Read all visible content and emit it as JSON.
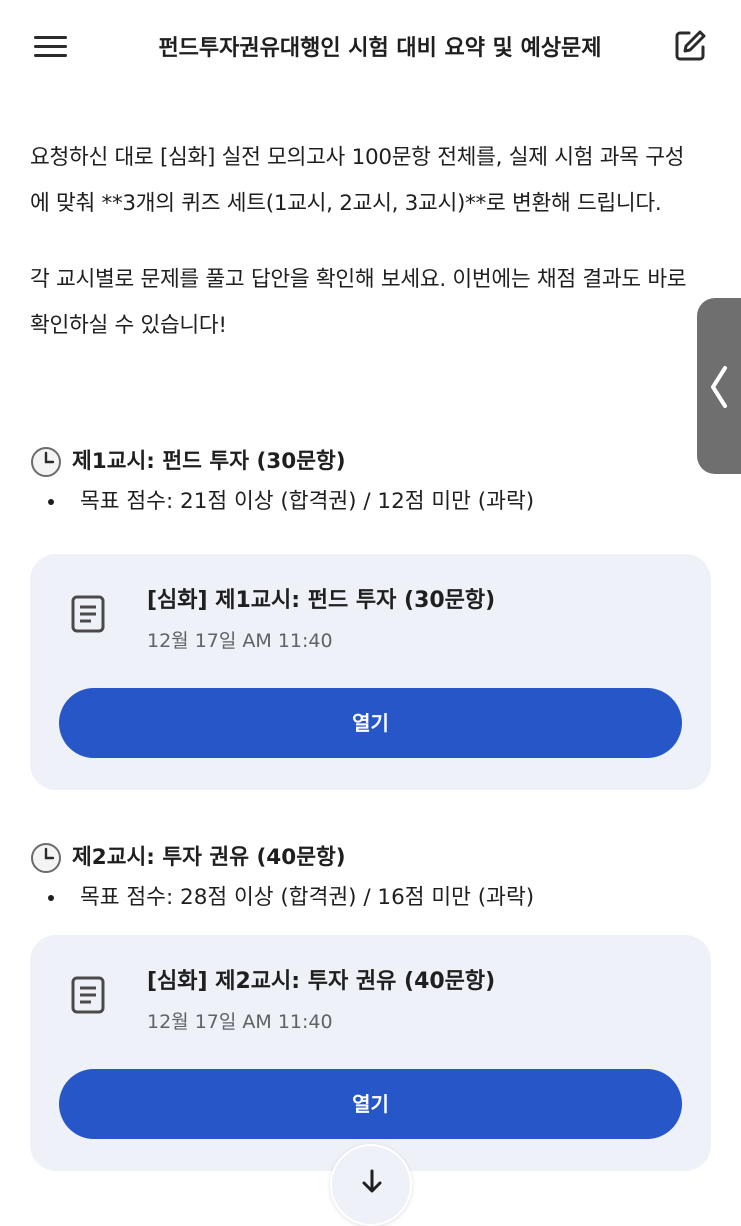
{
  "header": {
    "title": "펀드투자권유대행인 시험 대비 요약 및 예상문제"
  },
  "intro": {
    "paragraph1": "요청하신 대로 [심화] 실전 모의고사 100문항 전체를, 실제 시험 과목 구성에 맞춰 **3개의 퀴즈 세트(1교시, 2교시, 3교시)**로 변환해 드립니다.",
    "paragraph2": "각 교시별로 문제를 풀고 답안을 확인해 보세요. 이번에는 채점 결과도 바로 확인하실 수 있습니다!"
  },
  "sessions": [
    {
      "heading": "제1교시: 펀드 투자 (30문항)",
      "target": "목표 점수: 21점 이상 (합격권) / 12점 미만 (과락)",
      "card": {
        "title": "[심화] 제1교시: 펀드 투자 (30문항)",
        "timestamp": "12월 17일 AM 11:40",
        "button_label": "열기"
      }
    },
    {
      "heading": "제2교시: 투자 권유 (40문항)",
      "target": "목표 점수: 28점 이상 (합격권) / 16점 미만 (과락)",
      "card": {
        "title": "[심화] 제2교시: 투자 권유 (40문항)",
        "timestamp": "12월 17일 AM 11:40",
        "button_label": "열기"
      }
    }
  ],
  "icons": {
    "menu": "hamburger-menu-icon",
    "edit": "edit-icon",
    "clock": "clock-icon",
    "document": "document-icon",
    "side_tab": "chevron-left-icon",
    "scroll": "arrow-down-icon"
  },
  "colors": {
    "accent": "#2756c9",
    "card_background": "#eef1f7",
    "side_tab": "#6f6f6f"
  }
}
